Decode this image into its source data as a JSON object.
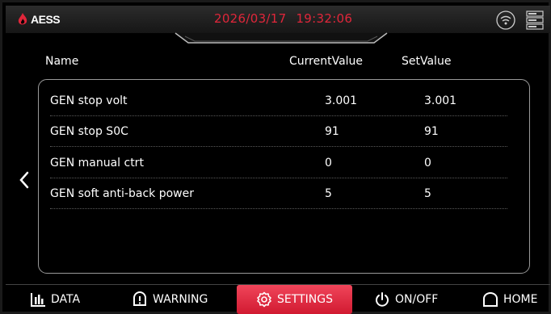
{
  "header": {
    "brand": "AESS",
    "date": "2026/03/17",
    "time": "19:32:06",
    "accent_color": "#e0263a"
  },
  "icons": {
    "logo": "flame-logo-icon",
    "wifi": "wifi-icon",
    "server": "server-icon",
    "back": "chevron-left-icon"
  },
  "columns": {
    "name": "Name",
    "current": "CurrentValue",
    "set": "SetValue"
  },
  "rows": [
    {
      "name": "GEN stop volt",
      "current": "3.001",
      "set": "3.001"
    },
    {
      "name": "GEN stop S0C",
      "current": "91",
      "set": "91"
    },
    {
      "name": "GEN manual ctrt",
      "current": "0",
      "set": "0"
    },
    {
      "name": "GEN soft anti-back power",
      "current": "5",
      "set": "5"
    }
  ],
  "nav": {
    "data": "DATA",
    "warning": "WARNING",
    "settings": "SETTINGS",
    "onoff": "ON/OFF",
    "home": "HOME",
    "active": "settings",
    "active_color": "#e8314a"
  }
}
